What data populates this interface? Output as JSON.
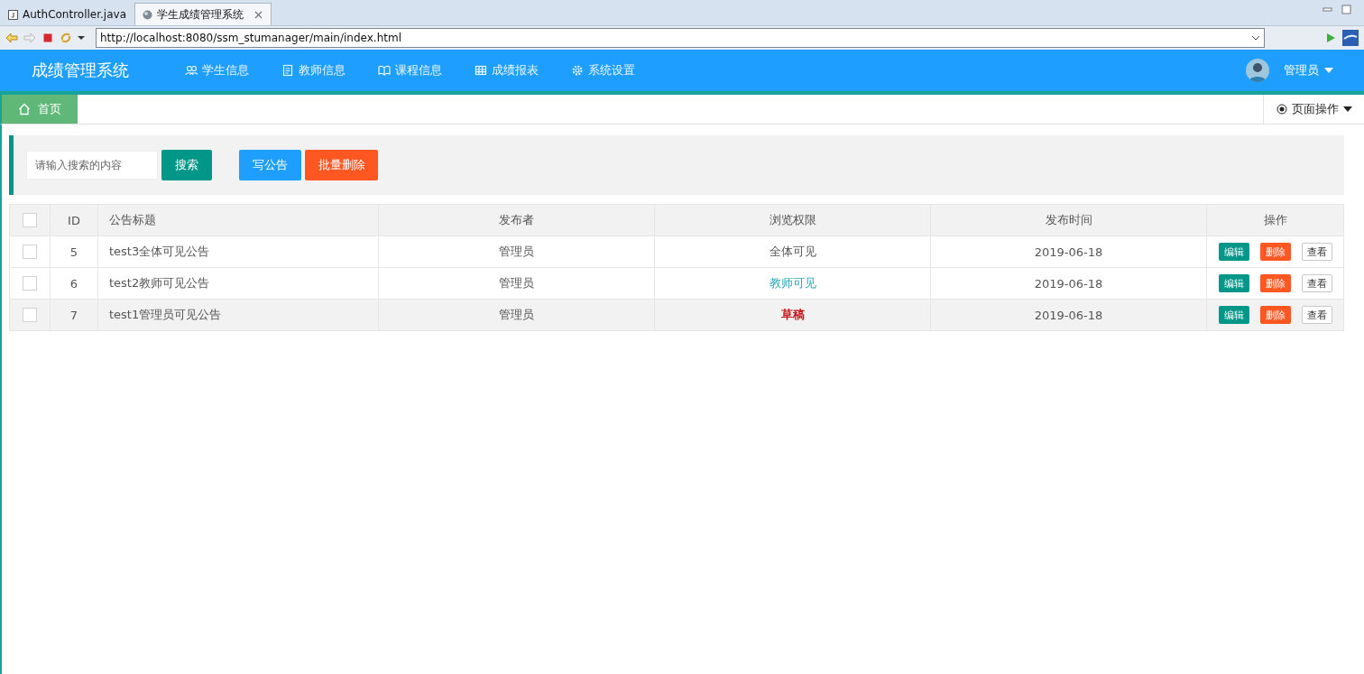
{
  "browser": {
    "tabs": [
      {
        "label": "AuthController.java",
        "selected": false,
        "kind": "java"
      },
      {
        "label": "学生成绩管理系统",
        "selected": true,
        "kind": "web"
      }
    ],
    "url": "http://localhost:8080/ssm_stumanager/main/index.html"
  },
  "header": {
    "title": "成绩管理系统",
    "nav": [
      {
        "label": "学生信息"
      },
      {
        "label": "教师信息"
      },
      {
        "label": "课程信息"
      },
      {
        "label": "成绩报表"
      },
      {
        "label": "系统设置"
      }
    ],
    "user": "管理员"
  },
  "page_tabs": [
    {
      "label": "首页",
      "selected": true
    }
  ],
  "page_ops": "页面操作",
  "toolbar": {
    "search": {
      "placeholder": "请输入搜索的内容"
    },
    "search_button": "搜索",
    "write_button": "写公告",
    "bulk_delete_button": "批量删除"
  },
  "table": {
    "columns": [
      "ID",
      "公告标题",
      "发布者",
      "浏览权限",
      "发布时间",
      "操作"
    ],
    "header_checked": false,
    "rows": [
      {
        "checked": false,
        "selected": false,
        "id": "5",
        "title": "test3全体可见公告",
        "publisher": "管理员",
        "access": {
          "text": "全体可见",
          "color": "#555555",
          "bold": false
        },
        "time": "2019-06-18",
        "actions": [
          "编辑",
          "删除",
          "查看"
        ]
      },
      {
        "checked": false,
        "selected": false,
        "id": "6",
        "title": "test2教师可见公告",
        "publisher": "管理员",
        "access": {
          "text": "教师可见",
          "color": "#2aa3b8",
          "bold": false
        },
        "time": "2019-06-18",
        "actions": [
          "编辑",
          "删除",
          "查看"
        ]
      },
      {
        "checked": false,
        "selected": true,
        "id": "7",
        "title": "test1管理员可见公告",
        "publisher": "管理员",
        "access": {
          "text": "草稿",
          "color": "#c9161d",
          "bold": true
        },
        "time": "2019-06-18",
        "actions": [
          "编辑",
          "删除",
          "查看"
        ]
      }
    ]
  }
}
